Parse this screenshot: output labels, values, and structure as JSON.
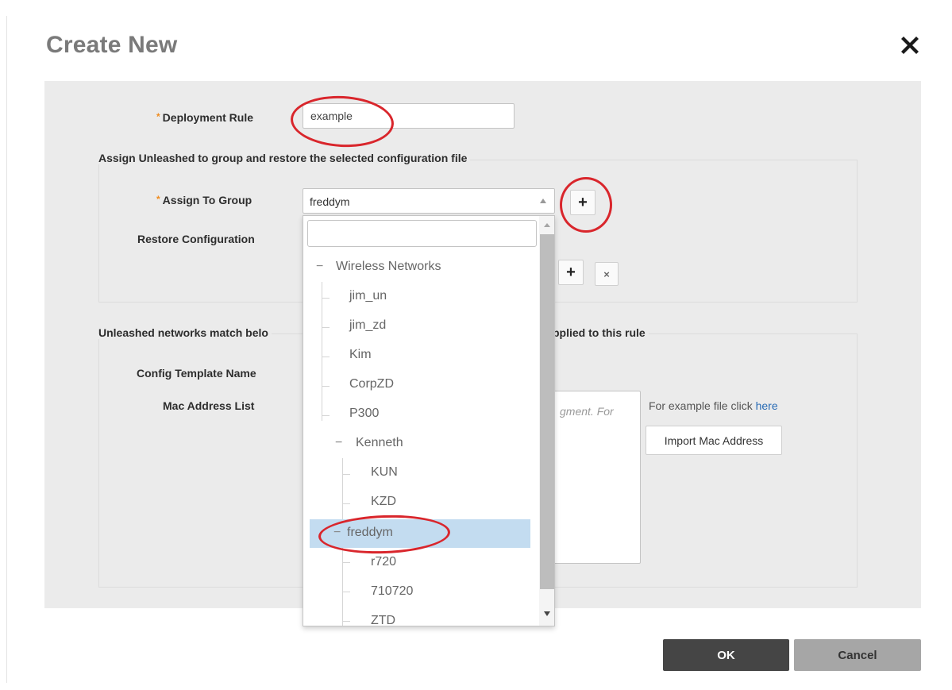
{
  "dialog": {
    "title": "Create New",
    "close_icon": "close-icon"
  },
  "form": {
    "deployment_rule": {
      "label": "Deployment Rule",
      "required_mark": "*",
      "value": "example"
    },
    "assign_section": {
      "legend": "Assign Unleashed to group and restore the selected configuration file",
      "assign_to_group": {
        "label": "Assign To Group",
        "required_mark": "*",
        "value": "freddym",
        "add_label": "+"
      },
      "restore_configuration": {
        "label": "Restore Configuration",
        "add_label": "+",
        "clear_label": "×"
      }
    },
    "match_section": {
      "legend_left": "Unleashed networks match belo",
      "legend_right": "pplied to this rule",
      "config_template_name": {
        "label": "Config Template Name"
      },
      "mac_address_list": {
        "label": "Mac Address List",
        "placeholder_fragment": "gment. For",
        "hint_text": "For example file click ",
        "hint_link": "here",
        "import_label": "Import Mac Address"
      }
    }
  },
  "group_dropdown": {
    "search_value": "",
    "tree": [
      {
        "label": "Wireless Networks",
        "toggle": "−"
      },
      {
        "label": "jim_un"
      },
      {
        "label": "jim_zd"
      },
      {
        "label": "Kim"
      },
      {
        "label": "CorpZD"
      },
      {
        "label": "P300"
      },
      {
        "label": "Kenneth",
        "toggle": "−"
      },
      {
        "label": "KUN"
      },
      {
        "label": "KZD"
      },
      {
        "label": "freddym",
        "toggle": "−",
        "selected": true
      },
      {
        "label": "r720"
      },
      {
        "label": "710720"
      },
      {
        "label": "ZTD"
      }
    ]
  },
  "footer": {
    "ok_label": "OK",
    "cancel_label": "Cancel"
  },
  "colors": {
    "annotation": "#d9262c",
    "required": "#f08c1e",
    "selected_row": "#c3dcf0",
    "panel": "#ebebeb",
    "ok_button": "#454545",
    "cancel_button": "#a6a6a6",
    "link": "#2a6cb5"
  }
}
